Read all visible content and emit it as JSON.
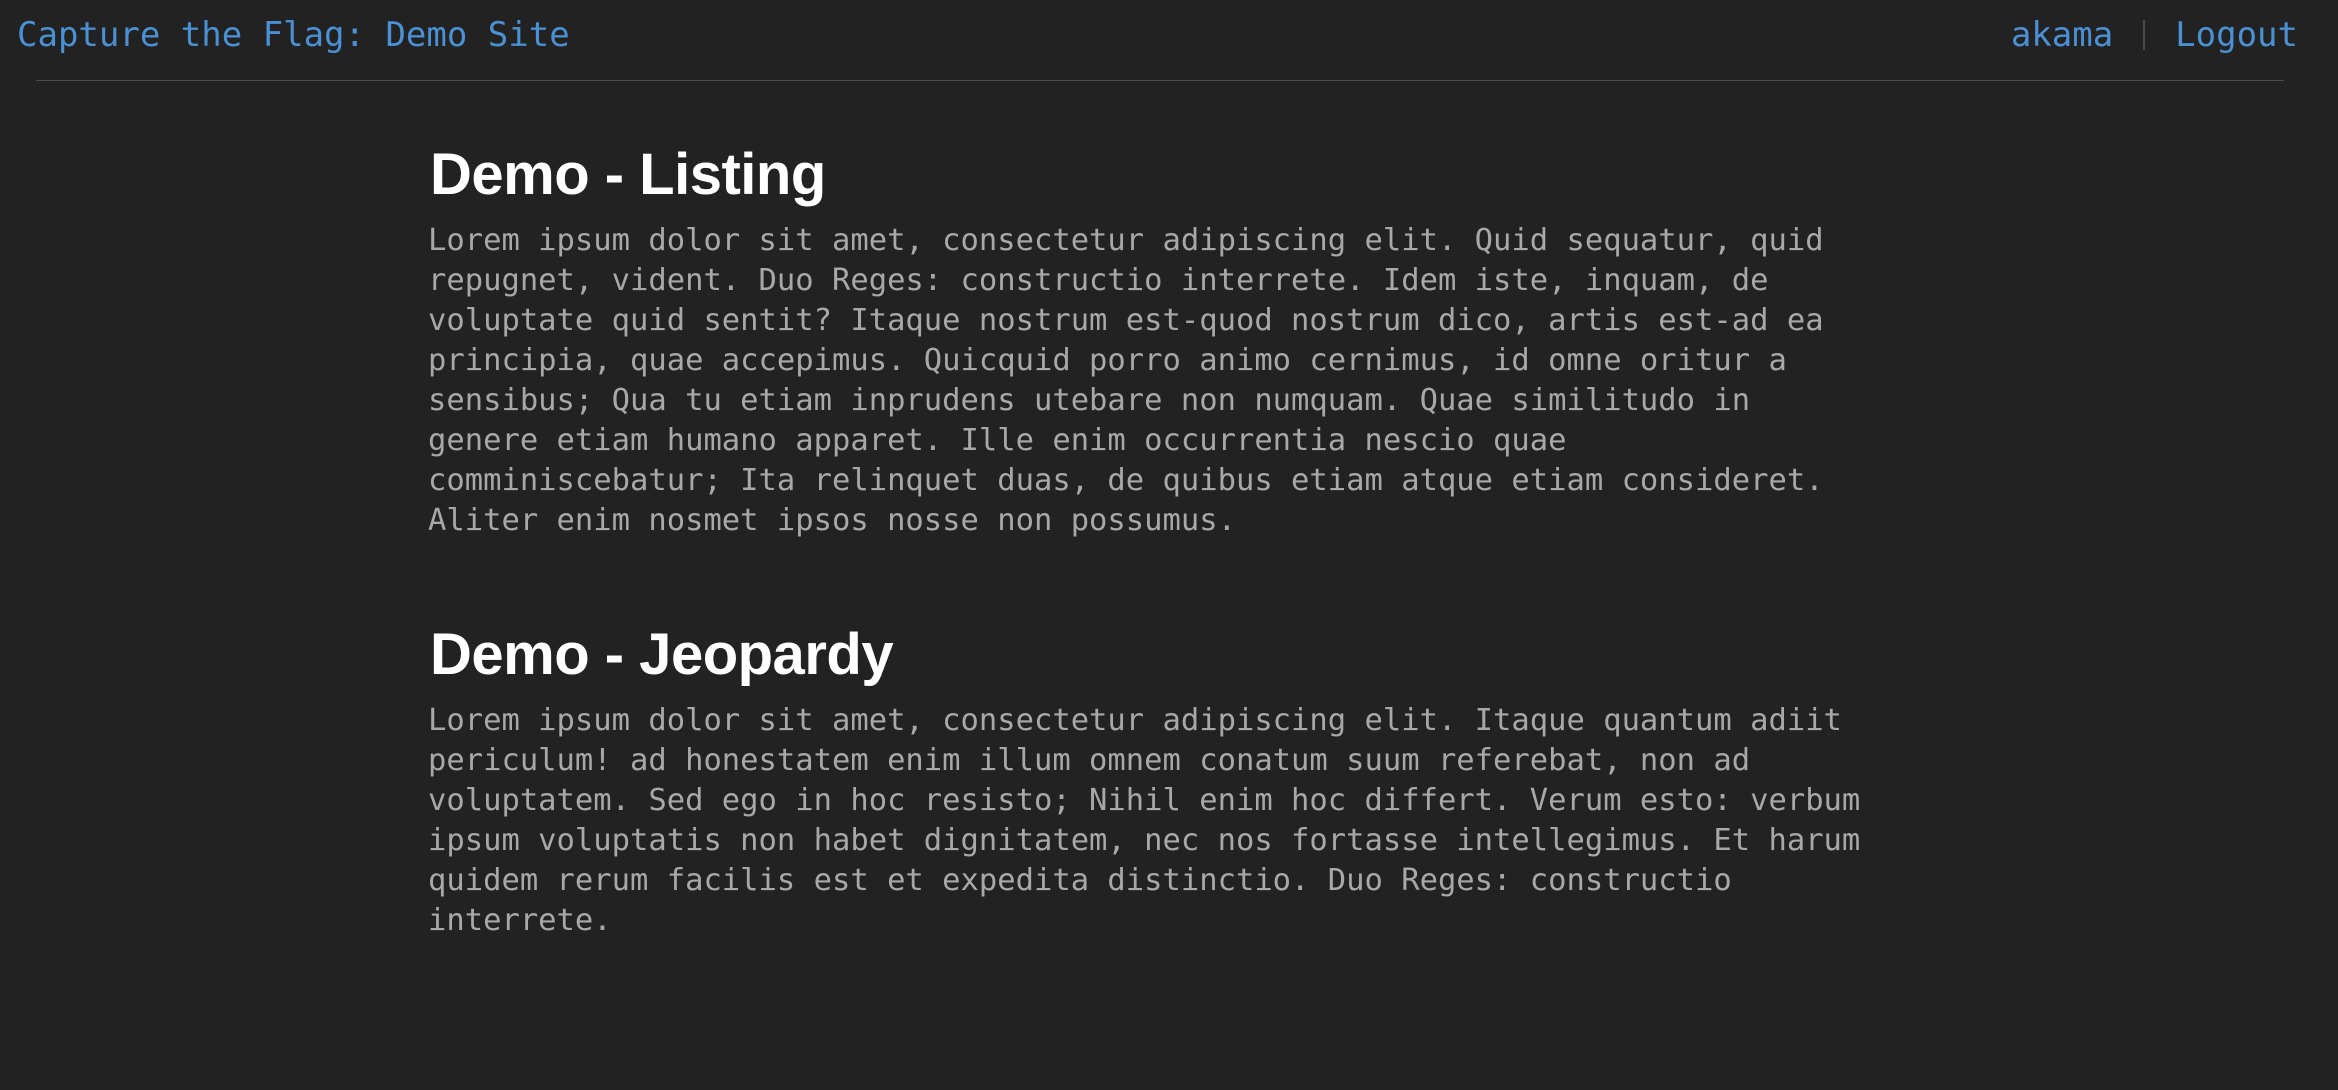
{
  "header": {
    "site_title": "Capture the Flag: Demo Site",
    "username": "akama",
    "logout_label": "Logout"
  },
  "sections": [
    {
      "title": "Demo - Listing",
      "text": "Lorem ipsum dolor sit amet, consectetur adipiscing elit. Quid sequatur, quid\nrepugnet, vident. Duo Reges: constructio interrete. Idem iste, inquam, de\nvoluptate quid sentit? Itaque nostrum est-quod nostrum dico, artis est-ad ea\nprincipia, quae accepimus. Quicquid porro animo cernimus, id omne oritur a\nsensibus; Qua tu etiam inprudens utebare non numquam. Quae similitudo in\ngenere etiam humano apparet. Ille enim occurrentia nescio quae\ncomminiscebatur; Ita relinquet duas, de quibus etiam atque etiam consideret.\nAliter enim nosmet ipsos nosse non possumus."
    },
    {
      "title": "Demo - Jeopardy",
      "text": "Lorem ipsum dolor sit amet, consectetur adipiscing elit. Itaque quantum adiit\npericulum! ad honestatem enim illum omnem conatum suum referebat, non ad\nvoluptatem. Sed ego in hoc resisto; Nihil enim hoc differt. Verum esto: verbum\nipsum voluptatis non habet dignitatem, nec nos fortasse intellegimus. Et harum\nquidem rerum facilis est et expedita distinctio. Duo Reges: constructio\ninterrete."
    }
  ]
}
